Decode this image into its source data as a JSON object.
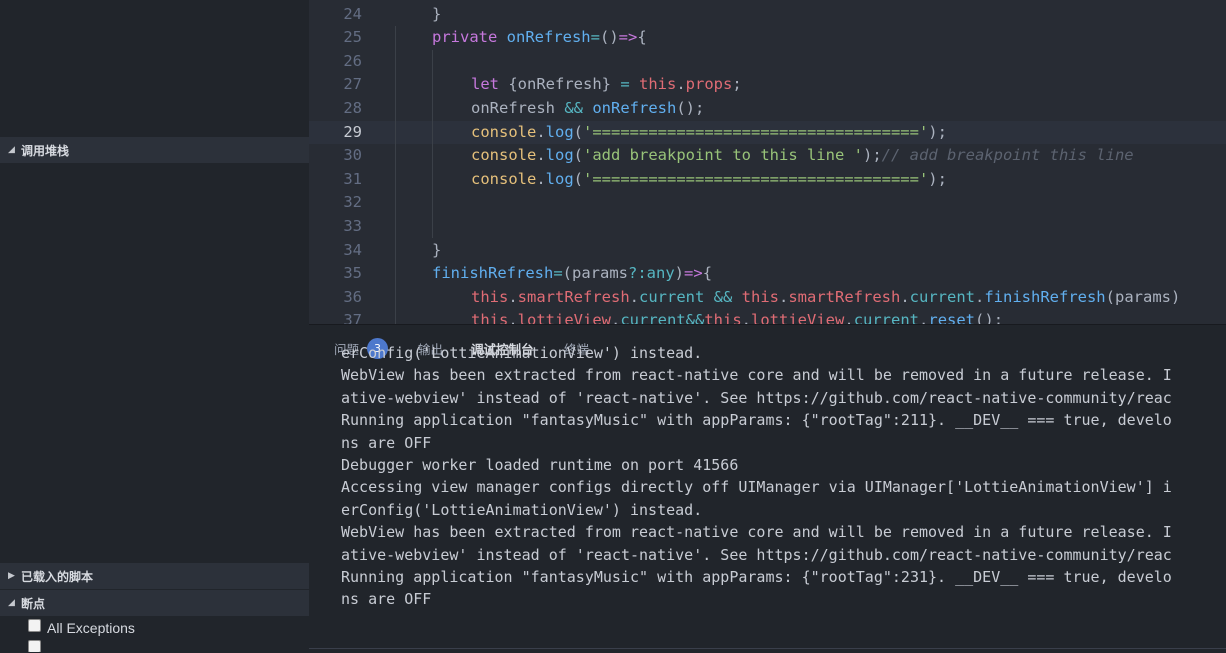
{
  "sidebar": {
    "call_stack_label": "调用堆栈",
    "loaded_scripts_label": "已载入的脚本",
    "breakpoints_label": "断点",
    "breakpoints": [
      {
        "label": "All Exceptions",
        "checked": false
      }
    ]
  },
  "editor": {
    "current_line": 29,
    "lines": [
      {
        "n": "24",
        "tokens": [
          {
            "t": "}",
            "c": ""
          }
        ],
        "indent": 0
      },
      {
        "n": "25",
        "tokens": [
          {
            "t": "private ",
            "c": "kw"
          },
          {
            "t": "onRefresh",
            "c": "fn"
          },
          {
            "t": "=",
            "c": "op"
          },
          {
            "t": "()",
            "c": ""
          },
          {
            "t": "=>",
            "c": "kw"
          },
          {
            "t": "{",
            "c": ""
          }
        ],
        "indent": 0
      },
      {
        "n": "26",
        "tokens": [],
        "indent": 1
      },
      {
        "n": "27",
        "tokens": [
          {
            "t": "let ",
            "c": "kw"
          },
          {
            "t": "{onRefresh} ",
            "c": ""
          },
          {
            "t": "= ",
            "c": "op"
          },
          {
            "t": "this",
            "c": "pr"
          },
          {
            "t": ".",
            "c": ""
          },
          {
            "t": "props",
            "c": "pr"
          },
          {
            "t": ";",
            "c": ""
          }
        ],
        "indent": 1
      },
      {
        "n": "28",
        "tokens": [
          {
            "t": "onRefresh ",
            "c": ""
          },
          {
            "t": "&& ",
            "c": "op"
          },
          {
            "t": "onRefresh",
            "c": "fn"
          },
          {
            "t": "();",
            "c": ""
          }
        ],
        "indent": 1
      },
      {
        "n": "29",
        "tokens": [
          {
            "t": "console",
            "c": "va"
          },
          {
            "t": ".",
            "c": ""
          },
          {
            "t": "log",
            "c": "fn"
          },
          {
            "t": "(",
            "c": ""
          },
          {
            "t": "'==================================='",
            "c": "st"
          },
          {
            "t": ");",
            "c": ""
          }
        ],
        "indent": 1
      },
      {
        "n": "30",
        "tokens": [
          {
            "t": "console",
            "c": "va"
          },
          {
            "t": ".",
            "c": ""
          },
          {
            "t": "log",
            "c": "fn"
          },
          {
            "t": "(",
            "c": ""
          },
          {
            "t": "'add breakpoint to this line '",
            "c": "st"
          },
          {
            "t": ");",
            "c": ""
          },
          {
            "t": "// add breakpoint this line",
            "c": "cm"
          }
        ],
        "indent": 1
      },
      {
        "n": "31",
        "tokens": [
          {
            "t": "console",
            "c": "va"
          },
          {
            "t": ".",
            "c": ""
          },
          {
            "t": "log",
            "c": "fn"
          },
          {
            "t": "(",
            "c": ""
          },
          {
            "t": "'==================================='",
            "c": "st"
          },
          {
            "t": ");",
            "c": ""
          }
        ],
        "indent": 1
      },
      {
        "n": "32",
        "tokens": [],
        "indent": 1
      },
      {
        "n": "33",
        "tokens": [],
        "indent": 1
      },
      {
        "n": "34",
        "tokens": [
          {
            "t": "}",
            "c": ""
          }
        ],
        "indent": 0
      },
      {
        "n": "35",
        "tokens": [
          {
            "t": "finishRefresh",
            "c": "fn"
          },
          {
            "t": "=",
            "c": "op"
          },
          {
            "t": "(params",
            "c": ""
          },
          {
            "t": "?:",
            "c": "op"
          },
          {
            "t": "any",
            "c": "ty"
          },
          {
            "t": ")",
            "c": ""
          },
          {
            "t": "=>",
            "c": "kw"
          },
          {
            "t": "{",
            "c": ""
          }
        ],
        "indent": 0
      },
      {
        "n": "36",
        "tokens": [
          {
            "t": "this",
            "c": "pr"
          },
          {
            "t": ".",
            "c": ""
          },
          {
            "t": "smartRefresh",
            "c": "pr"
          },
          {
            "t": ".",
            "c": ""
          },
          {
            "t": "current ",
            "c": "ty"
          },
          {
            "t": "&& ",
            "c": "op"
          },
          {
            "t": "this",
            "c": "pr"
          },
          {
            "t": ".",
            "c": ""
          },
          {
            "t": "smartRefresh",
            "c": "pr"
          },
          {
            "t": ".",
            "c": ""
          },
          {
            "t": "current",
            "c": "ty"
          },
          {
            "t": ".",
            "c": ""
          },
          {
            "t": "finishRefresh",
            "c": "fn"
          },
          {
            "t": "(params)",
            "c": ""
          }
        ],
        "indent": 1
      },
      {
        "n": "37",
        "tokens": [
          {
            "t": "this",
            "c": "pr"
          },
          {
            "t": ".",
            "c": ""
          },
          {
            "t": "lottieView",
            "c": "pr"
          },
          {
            "t": ".",
            "c": ""
          },
          {
            "t": "current",
            "c": "ty"
          },
          {
            "t": "&&",
            "c": "op"
          },
          {
            "t": "this",
            "c": "pr"
          },
          {
            "t": ".",
            "c": ""
          },
          {
            "t": "lottieView",
            "c": "pr"
          },
          {
            "t": ".",
            "c": ""
          },
          {
            "t": "current",
            "c": "ty"
          },
          {
            "t": ".",
            "c": ""
          },
          {
            "t": "reset",
            "c": "fn"
          },
          {
            "t": "();",
            "c": ""
          }
        ],
        "indent": 1
      }
    ]
  },
  "panel": {
    "tabs": [
      {
        "label": "问题",
        "badge": "3",
        "active": false
      },
      {
        "label": "输出",
        "active": false
      },
      {
        "label": "调试控制台",
        "active": true
      },
      {
        "label": "终端",
        "active": false
      }
    ],
    "console_lines": [
      "erConfig('LottieAnimationView') instead.",
      "WebView has been extracted from react-native core and will be removed in a future release. I",
      "ative-webview' instead of 'react-native'. See https://github.com/react-native-community/reac",
      "Running application \"fantasyMusic\" with appParams: {\"rootTag\":211}. __DEV__ === true, develo",
      "ns are OFF",
      "Debugger worker loaded runtime on port 41566",
      "Accessing view manager configs directly off UIManager via UIManager['LottieAnimationView'] i",
      "erConfig('LottieAnimationView') instead.",
      "WebView has been extracted from react-native core and will be removed in a future release. I",
      "ative-webview' instead of 'react-native'. See https://github.com/react-native-community/reac",
      "Running application \"fantasyMusic\" with appParams: {\"rootTag\":231}. __DEV__ === true, develo",
      "ns are OFF"
    ]
  }
}
